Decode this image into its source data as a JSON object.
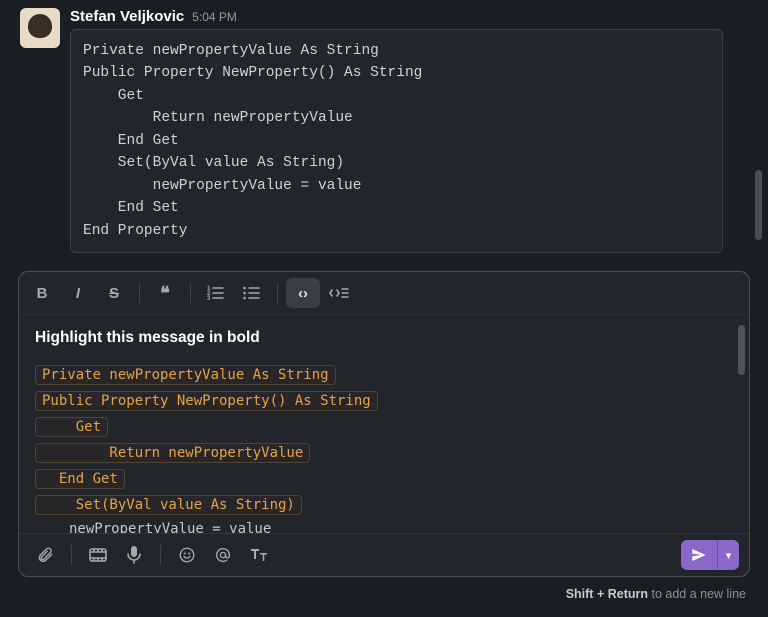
{
  "message": {
    "username": "Stefan Veljkovic",
    "timestamp": "5:04 PM",
    "code": "Private newPropertyValue As String\nPublic Property NewProperty() As String\n    Get\n        Return newPropertyValue\n    End Get\n    Set(ByVal value As String)\n        newPropertyValue = value\n    End Set\nEnd Property"
  },
  "composer": {
    "bold_text": "Highlight this message in bold",
    "code_lines": [
      "Private newPropertyValue As String",
      "Public Property NewProperty() As String",
      "    Get",
      "        Return newPropertyValue",
      "  End Get",
      "    Set(ByVal value As String)"
    ],
    "partial_line": "newPropertyValue = value"
  },
  "toolbar_top": {
    "bold": "B",
    "italic": "I",
    "strike": "S",
    "quote": "❝",
    "ol_icon": "ordered-list",
    "ul_icon": "unordered-list",
    "code": "‹›",
    "codeblock_icon": "code-block"
  },
  "hint": {
    "prefix": "Shift + Return",
    "suffix": " to add a new line"
  }
}
